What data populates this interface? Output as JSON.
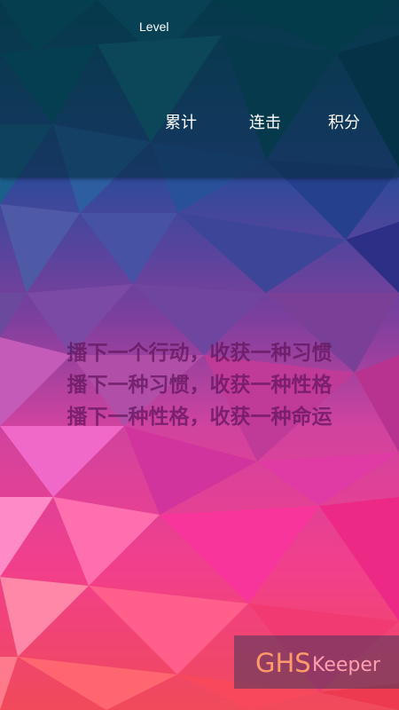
{
  "header": {
    "title": "Level",
    "tabs": [
      {
        "label": "累计"
      },
      {
        "label": "连击"
      },
      {
        "label": "积分"
      }
    ]
  },
  "quote": {
    "lines": [
      "播下一个行动，收获一种习惯",
      "播下一种习惯，收获一种性格",
      "播下一种性格，收获一种命运"
    ]
  },
  "brand": {
    "prefix": "GHS",
    "suffix": "Keeper"
  },
  "colors": {
    "header_tint": "#022834",
    "quote_text": "#5f145a",
    "brand_prefix": "#ff9a6a",
    "brand_suffix": "#ff9fb0"
  }
}
